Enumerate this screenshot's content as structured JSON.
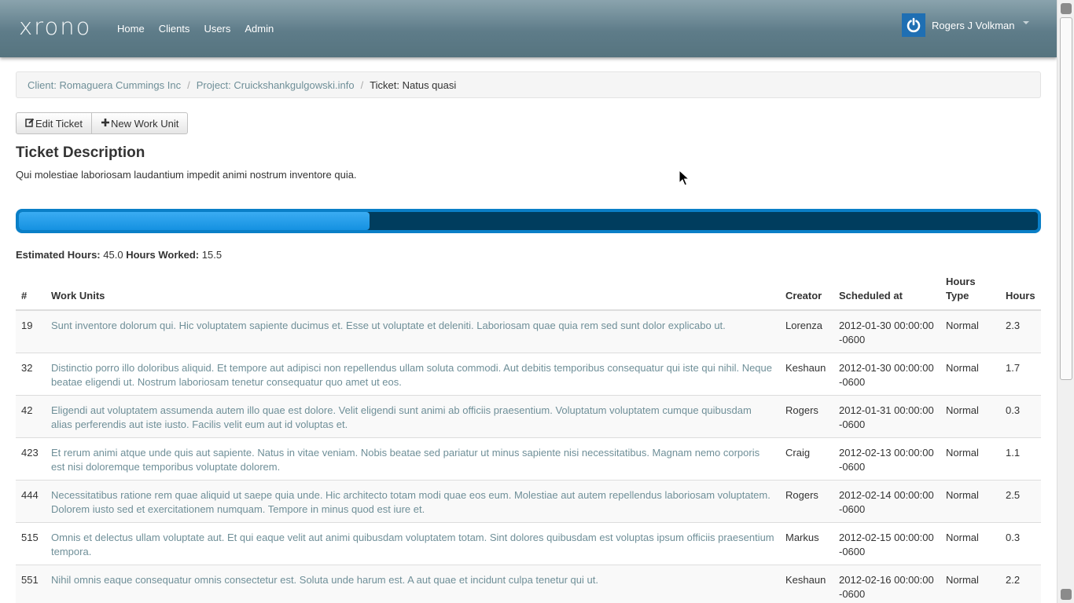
{
  "app": {
    "brand": "xrono"
  },
  "nav": {
    "items": [
      "Home",
      "Clients",
      "Users",
      "Admin"
    ]
  },
  "user": {
    "name": "Rogers J Volkman"
  },
  "breadcrumb": {
    "client": "Client: Romaguera Cummings Inc",
    "project": "Project: Cruickshankgulgowski.info",
    "ticket": "Ticket: Natus quasi",
    "separator": "/"
  },
  "toolbar": {
    "edit_label": "Edit Ticket",
    "new_label": "New Work Unit"
  },
  "ticket": {
    "title": "Ticket Description",
    "description": "Qui molestiae laboriosam laudantium impedit animi nostrum inventore quia."
  },
  "progress": {
    "fraction": 0.344
  },
  "hours": {
    "estimated_label": "Estimated Hours:",
    "estimated_value": "45.0",
    "worked_label": "Hours Worked:",
    "worked_value": "15.5"
  },
  "table": {
    "headers": [
      "#",
      "Work Units",
      "Creator",
      "Scheduled at",
      "Hours Type",
      "Hours"
    ],
    "rows": [
      {
        "id": "19",
        "text": "Sunt inventore dolorum qui. Hic voluptatem sapiente ducimus et. Esse ut voluptate et deleniti. Laboriosam quae quia rem sed sunt dolor explicabo ut.",
        "creator": "Lorenza",
        "scheduled": "2012-01-30 00:00:00 -0600",
        "type": "Normal",
        "hours": "2.3"
      },
      {
        "id": "32",
        "text": "Distinctio porro illo doloribus aliquid. Et tempore aut adipisci non repellendus ullam soluta commodi. Aut debitis temporibus consequatur qui iste qui nihil. Neque beatae eligendi ut. Nostrum laboriosam tenetur consequatur quo amet ut eos.",
        "creator": "Keshaun",
        "scheduled": "2012-01-30 00:00:00 -0600",
        "type": "Normal",
        "hours": "1.7"
      },
      {
        "id": "42",
        "text": "Eligendi aut voluptatem assumenda autem illo quae est dolore. Velit eligendi sunt animi ab officiis praesentium. Voluptatum voluptatem cumque quibusdam alias perferendis aut iste iusto. Facilis velit eum aut id voluptas et.",
        "creator": "Rogers",
        "scheduled": "2012-01-31 00:00:00 -0600",
        "type": "Normal",
        "hours": "0.3"
      },
      {
        "id": "423",
        "text": "Et rerum animi atque unde quis aut sapiente. Natus in vitae veniam. Nobis beatae sed pariatur ut minus sapiente nisi necessitatibus. Magnam nemo corporis est nisi doloremque temporibus voluptate dolorem.",
        "creator": "Craig",
        "scheduled": "2012-02-13 00:00:00 -0600",
        "type": "Normal",
        "hours": "1.1"
      },
      {
        "id": "444",
        "text": "Necessitatibus ratione rem quae aliquid ut saepe quia unde. Hic architecto totam modi quae eos eum. Molestiae aut autem repellendus laboriosam voluptatem. Dolorem iusto sed et exercitationem numquam. Tempore in minus quod est iure et.",
        "creator": "Rogers",
        "scheduled": "2012-02-14 00:00:00 -0600",
        "type": "Normal",
        "hours": "2.5"
      },
      {
        "id": "515",
        "text": "Omnis et delectus ullam voluptate aut. Et qui eaque velit aut animi quibusdam voluptatem totam. Sint dolores quibusdam est voluptas ipsum officiis praesentium tempora.",
        "creator": "Markus",
        "scheduled": "2012-02-15 00:00:00 -0600",
        "type": "Normal",
        "hours": "0.3"
      },
      {
        "id": "551",
        "text": "Nihil omnis eaque consequatur omnis consectetur est. Soluta unde harum est. A aut quae et incidunt culpa tenetur qui ut.",
        "creator": "Keshaun",
        "scheduled": "2012-02-16 00:00:00 -0600",
        "type": "Normal",
        "hours": "2.2"
      }
    ]
  },
  "icons": {
    "power": "power-icon",
    "edit": "edit-icon",
    "plus": "plus-icon",
    "caret": "caret-down-icon",
    "cursor": "mouse-pointer-icon"
  },
  "colors": {
    "navbar": "#5e7c89",
    "link": "#6f8f98",
    "progress_track": "#003d5e",
    "progress_fill": "#1591e1",
    "user_icon_bg": "#1f6fb3"
  }
}
